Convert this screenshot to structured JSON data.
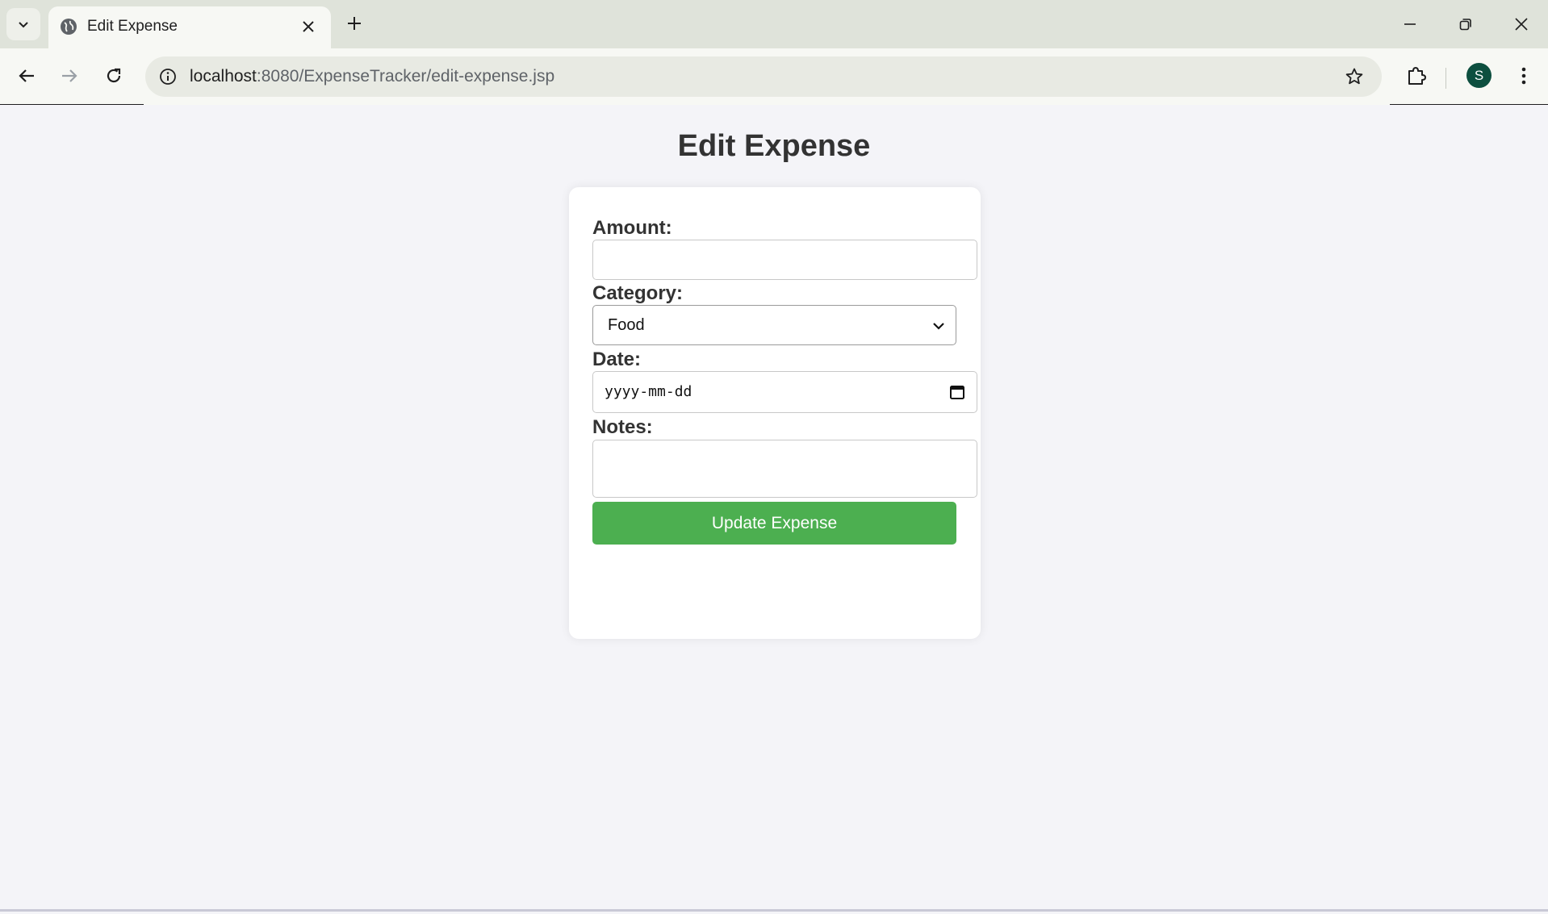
{
  "browser": {
    "tab_title": "Edit Expense",
    "url_host": "localhost",
    "url_rest": ":8080/ExpenseTracker/edit-expense.jsp",
    "profile_initial": "S",
    "icons": {
      "tab_menu": "chevron-down-icon",
      "favicon": "globe-icon",
      "tab_close": "close-icon",
      "new_tab": "plus-icon",
      "back": "arrow-left-icon",
      "forward": "arrow-right-icon",
      "reload": "reload-icon",
      "site_info": "info-icon",
      "bookmark": "star-icon",
      "extensions": "puzzle-icon",
      "menu": "kebab-menu-icon",
      "minimize": "minimize-icon",
      "restore": "restore-icon",
      "close_window": "close-icon"
    }
  },
  "page": {
    "title": "Edit Expense",
    "form": {
      "amount_label": "Amount:",
      "amount_value": "",
      "category_label": "Category:",
      "category_selected": "Food",
      "date_label": "Date:",
      "date_placeholder": "yyyy-mm-dd",
      "notes_label": "Notes:",
      "notes_value": "",
      "submit_label": "Update Expense"
    }
  },
  "colors": {
    "page_background": "#f4f4f8",
    "card_background": "#ffffff",
    "submit_button": "#4caf50",
    "avatar": "#0d4f3f",
    "tabstrip": "#dfe3da"
  }
}
